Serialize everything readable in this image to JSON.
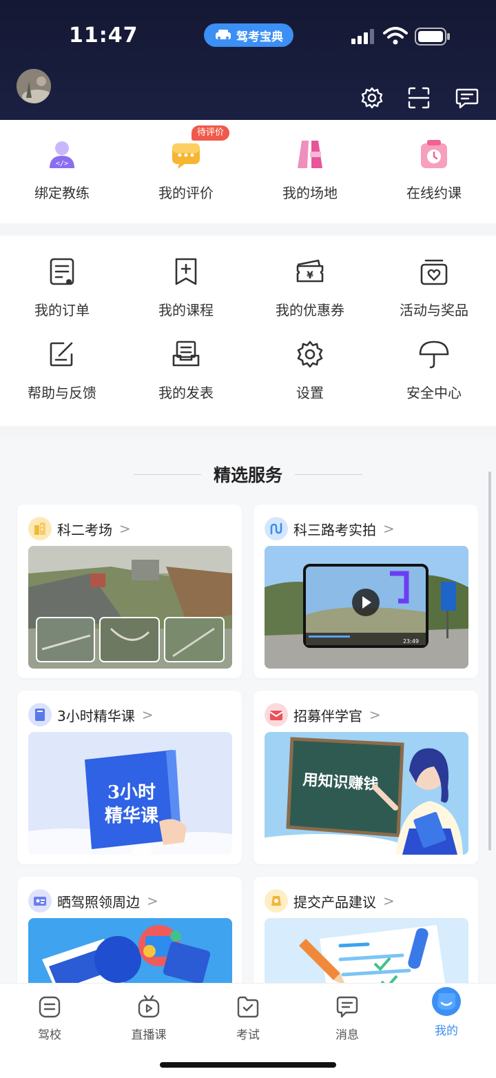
{
  "status_bar": {
    "time": "11:47",
    "app_pill": "驾考宝典"
  },
  "header": {
    "icons": [
      "settings-icon",
      "scan-icon",
      "message-icon"
    ]
  },
  "top_grid": [
    {
      "label": "绑定教练",
      "icon": "coach-icon",
      "color": "#8b7bf2"
    },
    {
      "label": "我的评价",
      "icon": "review-icon",
      "color": "#f6b132",
      "badge": "待评价"
    },
    {
      "label": "我的场地",
      "icon": "venue-icon",
      "color": "#ec5f9b"
    },
    {
      "label": "在线约课",
      "icon": "booking-icon",
      "color": "#f05d8a"
    }
  ],
  "menu_grid": [
    {
      "label": "我的订单",
      "icon": "order-icon"
    },
    {
      "label": "我的课程",
      "icon": "course-icon"
    },
    {
      "label": "我的优惠券",
      "icon": "coupon-icon"
    },
    {
      "label": "活动与奖品",
      "icon": "gift-icon"
    },
    {
      "label": "帮助与反馈",
      "icon": "feedback-icon"
    },
    {
      "label": "我的发表",
      "icon": "posts-icon"
    },
    {
      "label": "设置",
      "icon": "gear-icon"
    },
    {
      "label": "安全中心",
      "icon": "umbrella-icon"
    }
  ],
  "services": {
    "title": "精选服务",
    "cards": [
      {
        "title": "科二考场",
        "icon": "building-icon",
        "icon_color": "#f3b83a"
      },
      {
        "title": "科三路考实拍",
        "icon": "route-icon",
        "icon_color": "#3e8df0"
      },
      {
        "title": "3小时精华课",
        "icon": "book-icon",
        "icon_color": "#5a78e8",
        "image_text": [
          "3小时",
          "精华课"
        ]
      },
      {
        "title": "招募伴学官",
        "icon": "mail-icon",
        "icon_color": "#e9525c",
        "image_text": [
          "用知识赚钱"
        ]
      },
      {
        "title": "晒驾照领周边",
        "icon": "license-icon",
        "icon_color": "#6b7ef0"
      },
      {
        "title": "提交产品建议",
        "icon": "suggest-icon",
        "icon_color": "#f2b53a"
      }
    ],
    "video_time": "23:49"
  },
  "tabbar": [
    {
      "label": "驾校",
      "icon": "school-icon",
      "active": false
    },
    {
      "label": "直播课",
      "icon": "live-icon",
      "active": false
    },
    {
      "label": "考试",
      "icon": "exam-icon",
      "active": false
    },
    {
      "label": "消息",
      "icon": "message-icon",
      "active": false
    },
    {
      "label": "我的",
      "icon": "profile-icon",
      "active": true
    }
  ],
  "colors": {
    "header_bg": "#161a38",
    "accent": "#3b8ff5",
    "badge": "#f05a4a",
    "active_tab": "#3b8ff5"
  }
}
